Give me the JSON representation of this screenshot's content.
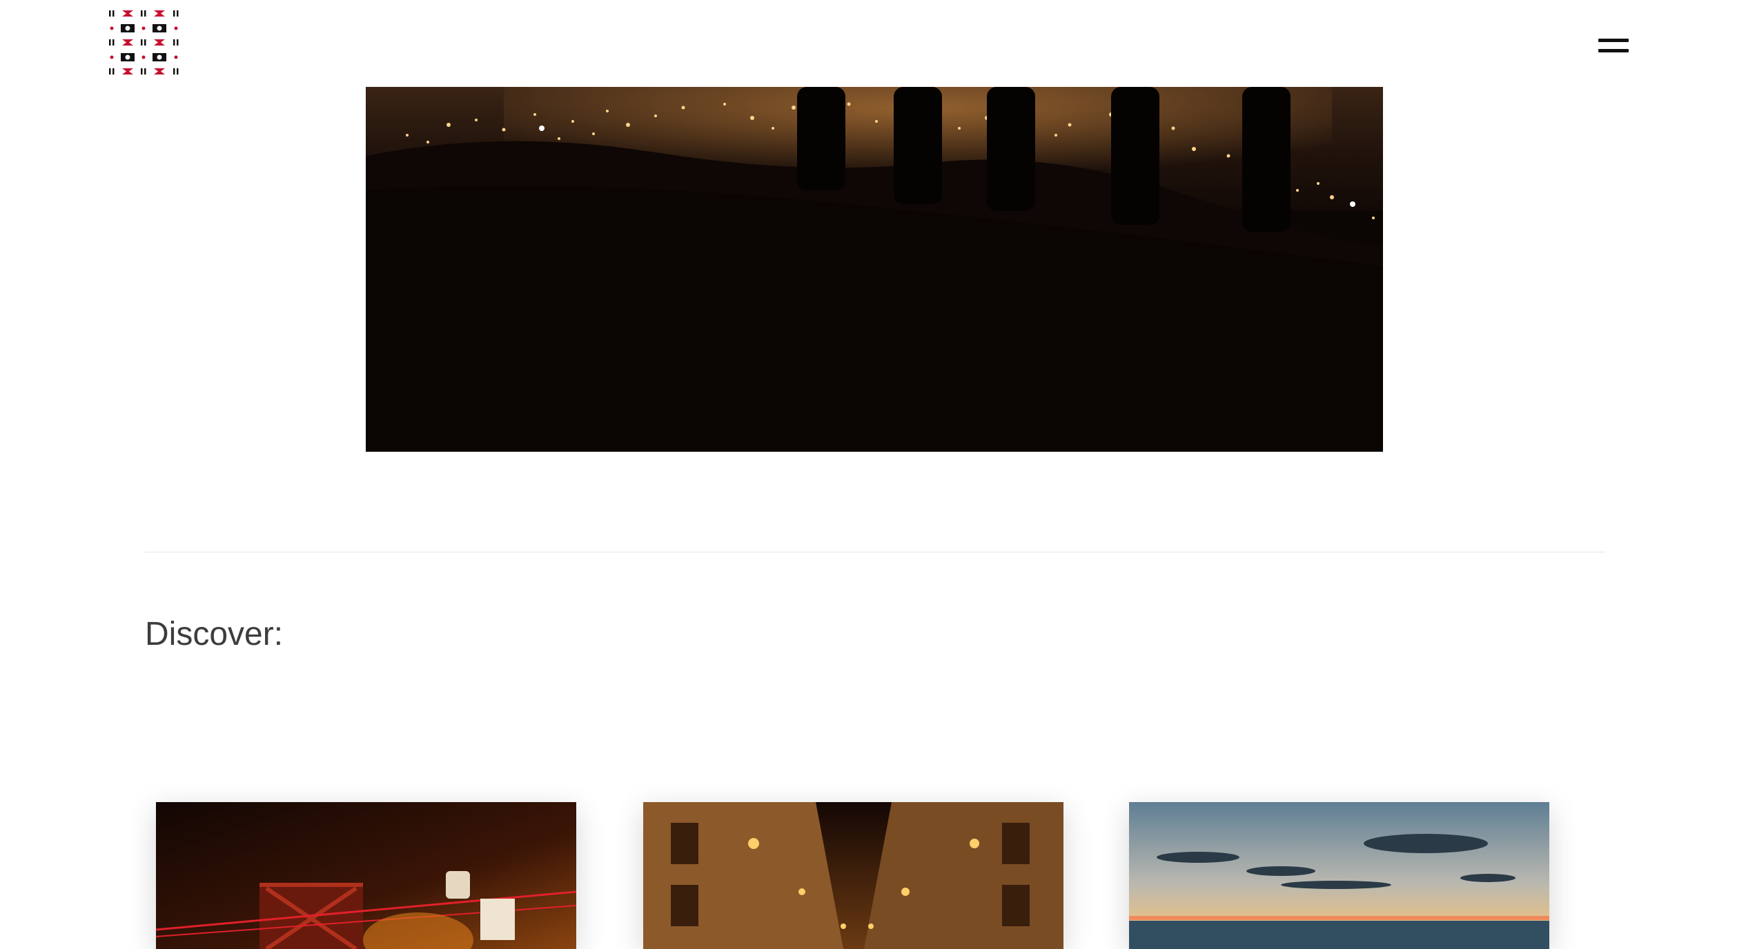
{
  "header": {
    "logo_name": "woven-pattern-logo",
    "menu_icon": "hamburger-menu-icon"
  },
  "hero": {
    "image": "night-city-view-silhouettes"
  },
  "discover": {
    "heading": "Discover:",
    "cards": [
      {
        "image": "night-bridge-street"
      },
      {
        "image": "night-heritage-street"
      },
      {
        "image": "sea-sunset"
      }
    ]
  },
  "colors": {
    "logo_red": "#c8102e",
    "logo_black": "#111111",
    "heading": "#3d3d3d",
    "divider": "#e6e6e6"
  }
}
